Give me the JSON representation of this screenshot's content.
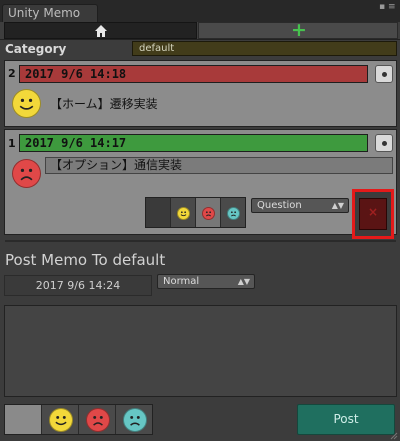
{
  "window": {
    "title": "Unity Memo"
  },
  "category": {
    "label": "Category",
    "selected": "default"
  },
  "memos": [
    {
      "index": "2",
      "date": "2017 9/6 14:18",
      "text": "【ホーム】遷移実装",
      "face": "happy",
      "header_color": "#a83a3a"
    },
    {
      "index": "1",
      "date": "2017 9/6 14:17",
      "text": "【オプション】通信実装",
      "face": "sad",
      "header_color": "#3e9a3e",
      "type": "Question"
    }
  ],
  "post": {
    "title": "Post Memo To default",
    "date": "2017 9/6 14:24",
    "type": "Normal",
    "button": "Post"
  },
  "colors": {
    "delete_highlight": "#e41a1a",
    "post_button": "#1f6f5f",
    "category_bg": "#423c1a"
  }
}
